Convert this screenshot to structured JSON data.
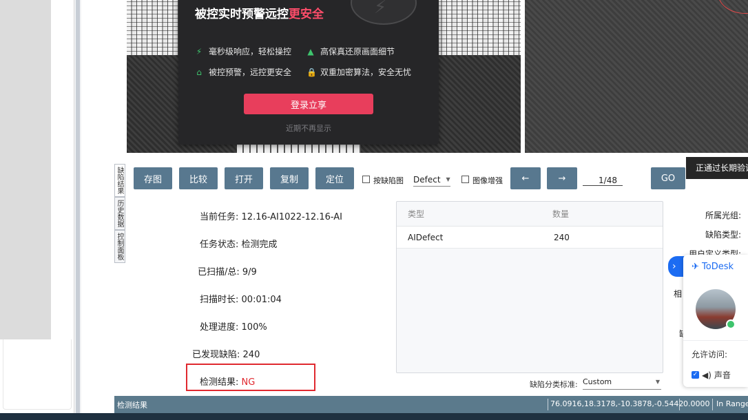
{
  "promo": {
    "title_main": "被控实时预警远控",
    "title_highlight": "更安全",
    "features": [
      {
        "icon": "bolt-icon",
        "glyph": "⚡",
        "text": "毫秒级响应，轻松操控"
      },
      {
        "icon": "image-icon",
        "glyph": "▲",
        "text": "高保真还原画面细节"
      },
      {
        "icon": "alert-house-icon",
        "glyph": "⌂",
        "text": "被控预警，远控更安全"
      },
      {
        "icon": "lock-icon",
        "glyph": "🔒",
        "text": "双重加密算法，安全无忧"
      }
    ],
    "login_label": "登录立享",
    "dismiss_label": "近期不再显示"
  },
  "side_tabs": [
    "缺陷结果",
    "历史数据",
    "控制面板"
  ],
  "toolbar": {
    "save_label": "存图",
    "compare_label": "比较",
    "open_label": "打开",
    "copy_label": "复制",
    "locate_label": "定位",
    "defect_map_label": "按缺陷图",
    "defect_combo_value": "Defect",
    "enhance_label": "图像增强",
    "prev_label": "←",
    "next_label": "→",
    "page_indicator": "1/48",
    "go_label": "GO"
  },
  "info": {
    "task_label": "当前任务:",
    "task_value": "12.16-AI1022-12.16-AI",
    "status_label": "任务状态:",
    "status_value": "检测完成",
    "scanned_label": "已扫描/总:",
    "scanned_value": "9/9",
    "duration_label": "扫描时长:",
    "duration_value": "00:01:04",
    "progress_label": "处理进度:",
    "progress_value": "100%",
    "defects_label": "已发现缺陷:",
    "defects_value": "240",
    "result_label": "检测结果:",
    "result_value": "NG"
  },
  "defect_table": {
    "col_type": "类型",
    "col_count": "数量",
    "rows": [
      {
        "type": "AIDefect",
        "count": "240"
      }
    ]
  },
  "classification": {
    "label": "缺陷分类标准:",
    "value": "Custom"
  },
  "right_panel": {
    "group_label": "所属光组:",
    "defect_type_label": "缺陷类型:",
    "custom_type_label": "用户定义类型:",
    "partial_1": "相",
    "partial_2": "缺"
  },
  "notification": "正通过长期验证",
  "todesk": {
    "brand": "ToDesk",
    "allow_label": "允许访问:",
    "sound_label": "声音",
    "expand": "›"
  },
  "status_bar": {
    "left": "检测结果",
    "coords": "76.0916,18.3178,-10.3878,-0.5442",
    "value": "0.0000",
    "range": "In Range"
  },
  "colors": {
    "toolbar_button": "#58788f",
    "status_bar": "#5b7a8c",
    "ng": "#e0282e",
    "promo_accent": "#e83e5c",
    "todesk_blue": "#1c6cf2"
  }
}
